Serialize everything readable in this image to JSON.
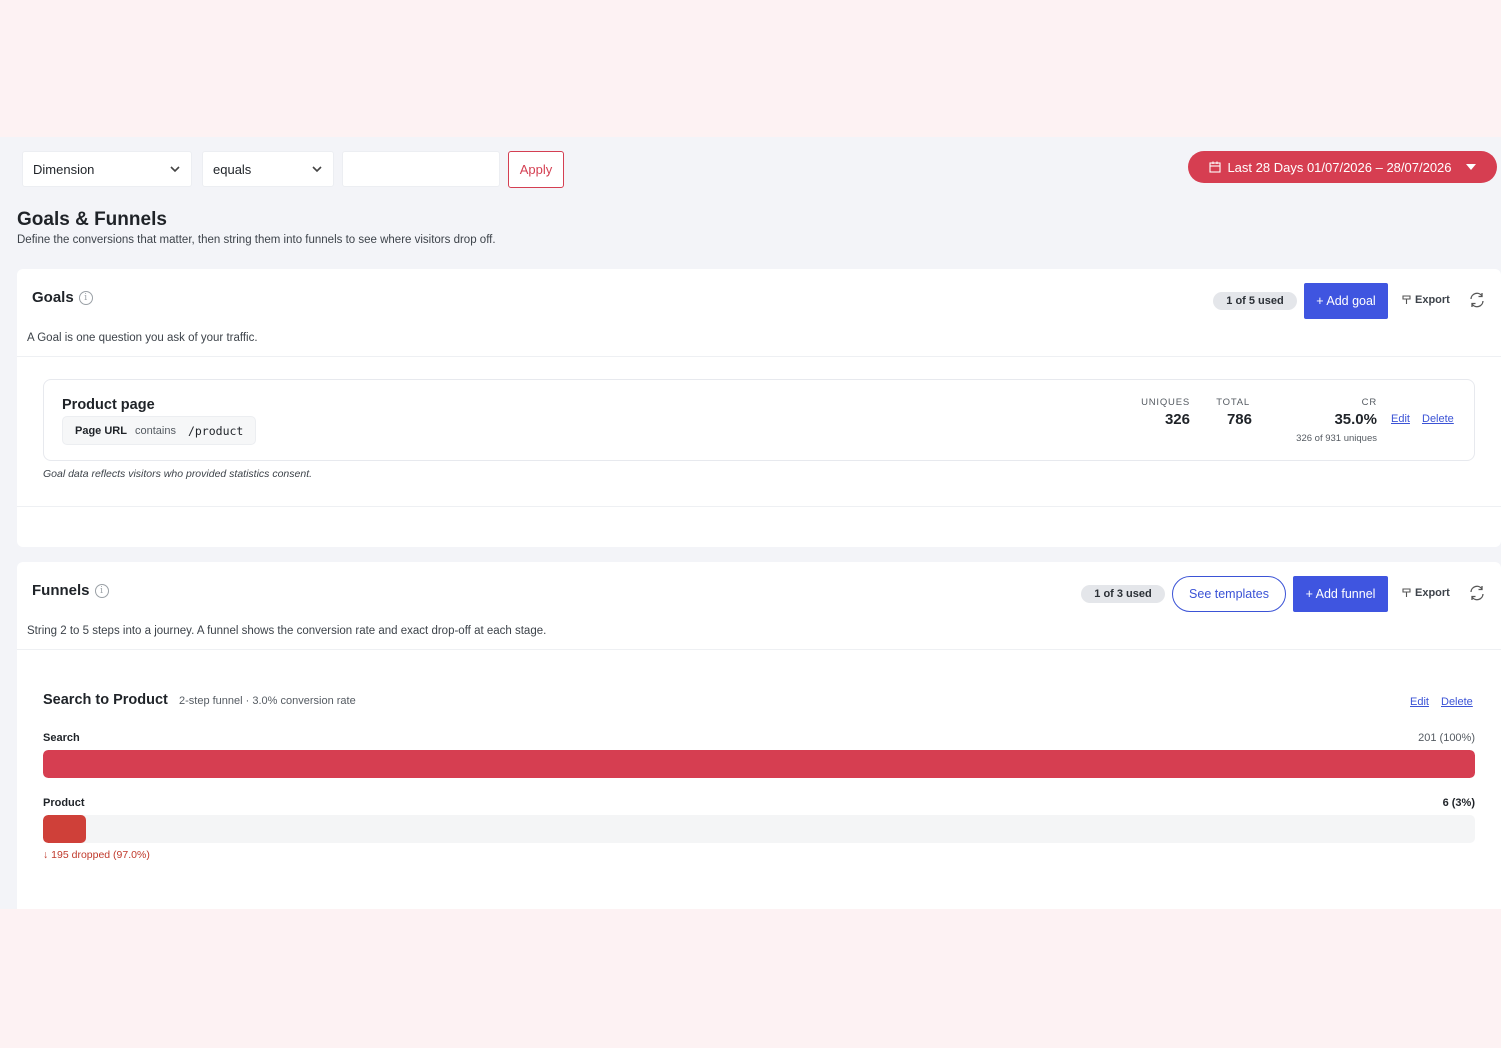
{
  "filters": {
    "dimension": "Dimension",
    "operator": "equals",
    "value": "",
    "apply_label": "Apply"
  },
  "date_range": {
    "label": "Last 28 Days 01/07/2026 – 28/07/2026"
  },
  "page": {
    "title": "Goals & Funnels",
    "subtitle": "Define the conversions that matter, then string them into funnels to see where visitors drop off."
  },
  "goals": {
    "title": "Goals",
    "description": "A Goal is one question you ask of your traffic.",
    "usage": "1 of 5 used",
    "add_label": "+ Add goal",
    "export_label": "Export",
    "items": [
      {
        "name": "Product page",
        "condition_key": "Page URL",
        "condition_op": "contains",
        "condition_value": "/product",
        "uniques_label": "UNIQUES",
        "uniques": "326",
        "total_label": "TOTAL",
        "total": "786",
        "cr_label": "CR",
        "cr": "35.0%",
        "cr_detail": "326 of 931 uniques",
        "edit_label": "Edit",
        "delete_label": "Delete"
      }
    ],
    "note": "Goal data reflects visitors who provided statistics consent."
  },
  "funnels": {
    "title": "Funnels",
    "description": "String 2 to 5 steps into a journey. A funnel shows the conversion rate and exact drop-off at each stage.",
    "usage": "1 of 3 used",
    "templates_label": "See templates",
    "add_label": "+ Add funnel",
    "export_label": "Export",
    "items": [
      {
        "name": "Search to Product",
        "meta": "2-step funnel · 3.0% conversion rate",
        "edit_label": "Edit",
        "delete_label": "Delete",
        "steps": [
          {
            "label": "Search",
            "count": "201  (100%)",
            "fraction": 1.0,
            "color": "#d63e51"
          },
          {
            "label": "Product",
            "count": "6  (3%)",
            "fraction": 0.03,
            "color": "#cf4039",
            "dropped": "↓ 195 dropped (97.0%)"
          }
        ]
      }
    ]
  },
  "colors": {
    "accent": "#d63e51",
    "primary": "#3f55e0",
    "link": "#3b53d6"
  },
  "icons": [
    "chevron-down-icon",
    "calendar-icon",
    "caret-down-icon",
    "info-icon",
    "export-icon",
    "refresh-icon"
  ]
}
